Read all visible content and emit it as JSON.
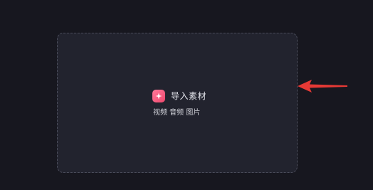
{
  "import_panel": {
    "title": "导入素材",
    "subtitle": "视频 音频 图片",
    "icon": "plus-icon",
    "accent_color": "#f0476d"
  },
  "annotation": {
    "icon": "red-arrow-left",
    "color": "#e53935"
  }
}
